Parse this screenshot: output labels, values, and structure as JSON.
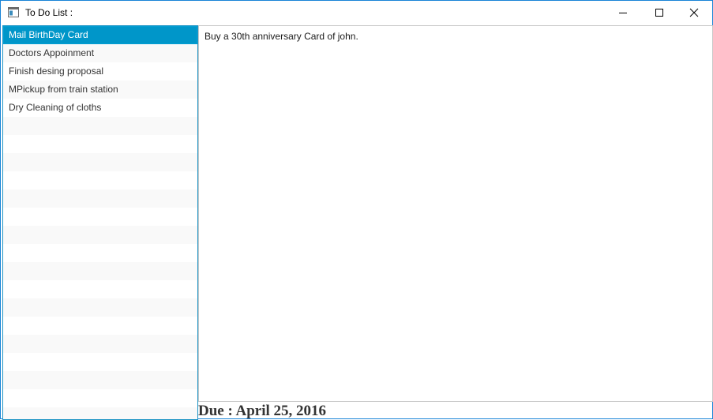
{
  "window": {
    "title": "To Do List :"
  },
  "todo_list": {
    "items": [
      {
        "label": "Mail BirthDay Card",
        "selected": true
      },
      {
        "label": "Doctors Appoinment",
        "selected": false
      },
      {
        "label": "Finish desing proposal",
        "selected": false
      },
      {
        "label": "MPickup from train station",
        "selected": false
      },
      {
        "label": "Dry Cleaning of cloths",
        "selected": false
      }
    ]
  },
  "details": {
    "text": "Buy a 30th anniversary Card of john."
  },
  "due": {
    "label": "Due :",
    "date": "April 25, 2016"
  },
  "colors": {
    "selection": "#0096c9",
    "list_border": "#1c93c4",
    "window_border": "#1883d7"
  }
}
